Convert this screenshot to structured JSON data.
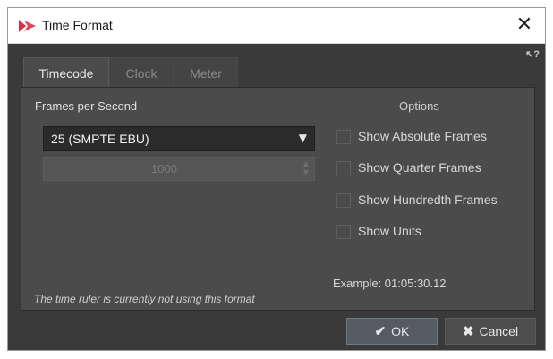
{
  "window": {
    "title": "Time Format",
    "close_symbol": "✕",
    "help_symbol": "↖?",
    "icons": {
      "app": "app-logo-icon",
      "close": "close-icon",
      "help": "context-help-icon"
    }
  },
  "tabs": [
    {
      "label": "Timecode",
      "active": true
    },
    {
      "label": "Clock",
      "active": false
    },
    {
      "label": "Meter",
      "active": false
    }
  ],
  "frames_per_second": {
    "group_label": "Frames per Second",
    "selected": "25 (SMPTE EBU)",
    "dropdown_arrow": "▼",
    "custom_value": "1000",
    "custom_enabled": false
  },
  "options": {
    "group_label": "Options",
    "items": [
      {
        "label": "Show Absolute Frames",
        "checked": false
      },
      {
        "label": "Show Quarter Frames",
        "checked": false
      },
      {
        "label": "Show Hundredth Frames",
        "checked": false
      },
      {
        "label": "Show Units",
        "checked": false
      }
    ]
  },
  "example_text": "Example: 01:05:30.12",
  "status_text": "The time ruler is currently not using this format",
  "buttons": {
    "ok": {
      "label": "OK",
      "glyph": "✔"
    },
    "cancel": {
      "label": "Cancel",
      "glyph": "✖"
    }
  },
  "colors": {
    "accent": "#d8304a",
    "dialog_bg": "#3a3a3a",
    "panel_bg": "#4b4b4b"
  }
}
